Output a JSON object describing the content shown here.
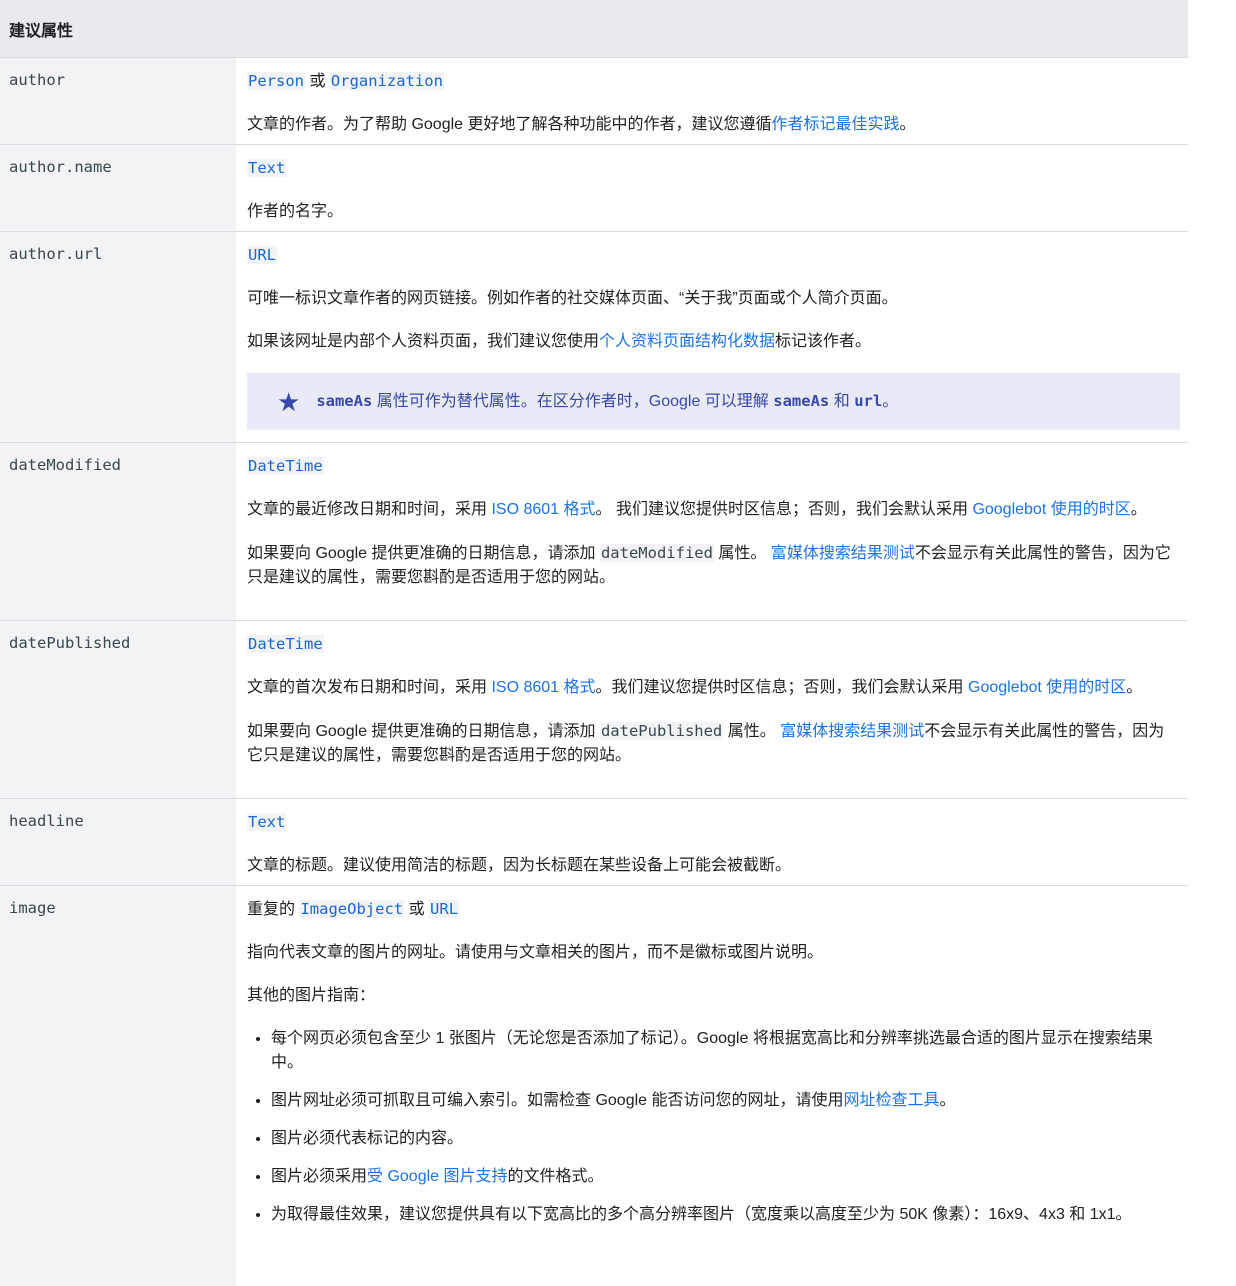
{
  "header": {
    "title": "建议属性"
  },
  "rows": {
    "author": {
      "name": "author",
      "type_a": "Person",
      "or": "或",
      "type_b": "Organization",
      "desc_text": "文章的作者。为了帮助 Google 更好地了解各种功能中的作者，建议您遵循",
      "desc_link": "作者标记最佳实践",
      "desc_end": "。"
    },
    "author_name": {
      "name": "author.name",
      "type": "Text",
      "desc": "作者的名字。"
    },
    "author_url": {
      "name": "author.url",
      "type": "URL",
      "desc1": "可唯一标识文章作者的网页链接。例如作者的社交媒体页面、“关于我”页面或个人简介页面。",
      "desc2_text": "如果该网址是内部个人资料页面，我们建议您使用",
      "desc2_link": "个人资料页面结构化数据",
      "desc2_end": "标记该作者。",
      "note": {
        "code1": "sameAs",
        "text1": "属性可作为替代属性。在区分作者时，Google 可以理解",
        "code2": "sameAs",
        "and": "和",
        "code3": "url",
        "end": "。"
      }
    },
    "date_modified": {
      "name": "dateModified",
      "type": "DateTime",
      "p1_a": "文章的最近修改日期和时间，采用",
      "p1_link1": "ISO 8601 格式",
      "p1_b": "。 我们建议您提供时区信息；否则，我们会默认采用",
      "p1_link2": "Googlebot 使用的时区",
      "p1_end": "。",
      "p2_a": "如果要向 Google 提供更准确的日期信息，请添加",
      "p2_code": "dateModified",
      "p2_b": "属性。",
      "p2_link": "富媒体搜索结果测试",
      "p2_c": "不会显示有关此属性的警告，因为它只是建议的属性，需要您斟酌是否适用于您的网站。"
    },
    "date_published": {
      "name": "datePublished",
      "type": "DateTime",
      "p1_a": "文章的首次发布日期和时间，采用",
      "p1_link1": "ISO 8601 格式",
      "p1_b": "。我们建议您提供时区信息；否则，我们会默认采用",
      "p1_link2": "Googlebot 使用的时区",
      "p1_end": "。",
      "p2_a": "如果要向 Google 提供更准确的日期信息，请添加",
      "p2_code": "datePublished",
      "p2_b": "属性。",
      "p2_link": "富媒体搜索结果测试",
      "p2_c": "不会显示有关此属性的警告，因为它只是建议的属性，需要您斟酌是否适用于您的网站。"
    },
    "headline": {
      "name": "headline",
      "type": "Text",
      "desc": "文章的标题。建议使用简洁的标题，因为长标题在某些设备上可能会被截断。"
    },
    "image": {
      "name": "image",
      "type_prefix": "重复的",
      "type_a": "ImageObject",
      "or": "或",
      "type_b": "URL",
      "desc1": "指向代表文章的图片的网址。请使用与文章相关的图片，而不是徽标或图片说明。",
      "desc2": "其他的图片指南：",
      "li1": "每个网页必须包含至少 1 张图片（无论您是否添加了标记）。Google 将根据宽高比和分辨率挑选最合适的图片显示在搜索结果中。",
      "li2_text": "图片网址必须可抓取且可编入索引。如需检查 Google 能否访问您的网址，请使用",
      "li2_link": "网址检查工具",
      "li2_end": "。",
      "li3": "图片必须代表标记的内容。",
      "li4_text": "图片必须采用",
      "li4_link": "受 Google 图片支持",
      "li4_end": "的文件格式。",
      "li5": "为取得最佳效果，建议您提供具有以下宽高比的多个高分辨率图片（宽度乘以高度至少为 50K 像素）：16x9、4x3 和 1x1。"
    }
  }
}
